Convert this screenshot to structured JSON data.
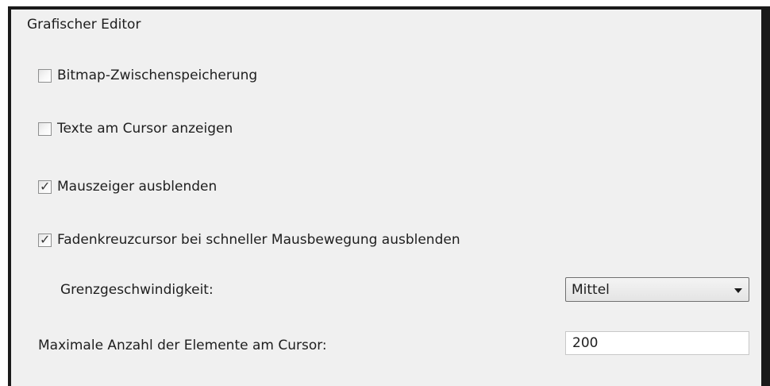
{
  "section": {
    "title": "Grafischer Editor"
  },
  "options": {
    "bitmap_caching": {
      "label": "Bitmap-Zwischenspeicherung",
      "checked": false
    },
    "show_text_at_cursor": {
      "label": "Texte am Cursor anzeigen",
      "checked": false
    },
    "hide_mouse_pointer": {
      "label": "Mauszeiger ausblenden",
      "checked": true,
      "check_glyph": "✓"
    },
    "hide_crosshair": {
      "label": "Fadenkreuzcursor bei schneller Mausbewegung ausblenden",
      "checked": true,
      "check_glyph": "✓"
    }
  },
  "speed_threshold": {
    "label": "Grenzgeschwindigkeit:",
    "selected": "Mittel"
  },
  "max_elements": {
    "label": "Maximale Anzahl der Elemente am Cursor:",
    "value": "200"
  },
  "icons": {
    "dropdown": "chevron-down-icon"
  }
}
